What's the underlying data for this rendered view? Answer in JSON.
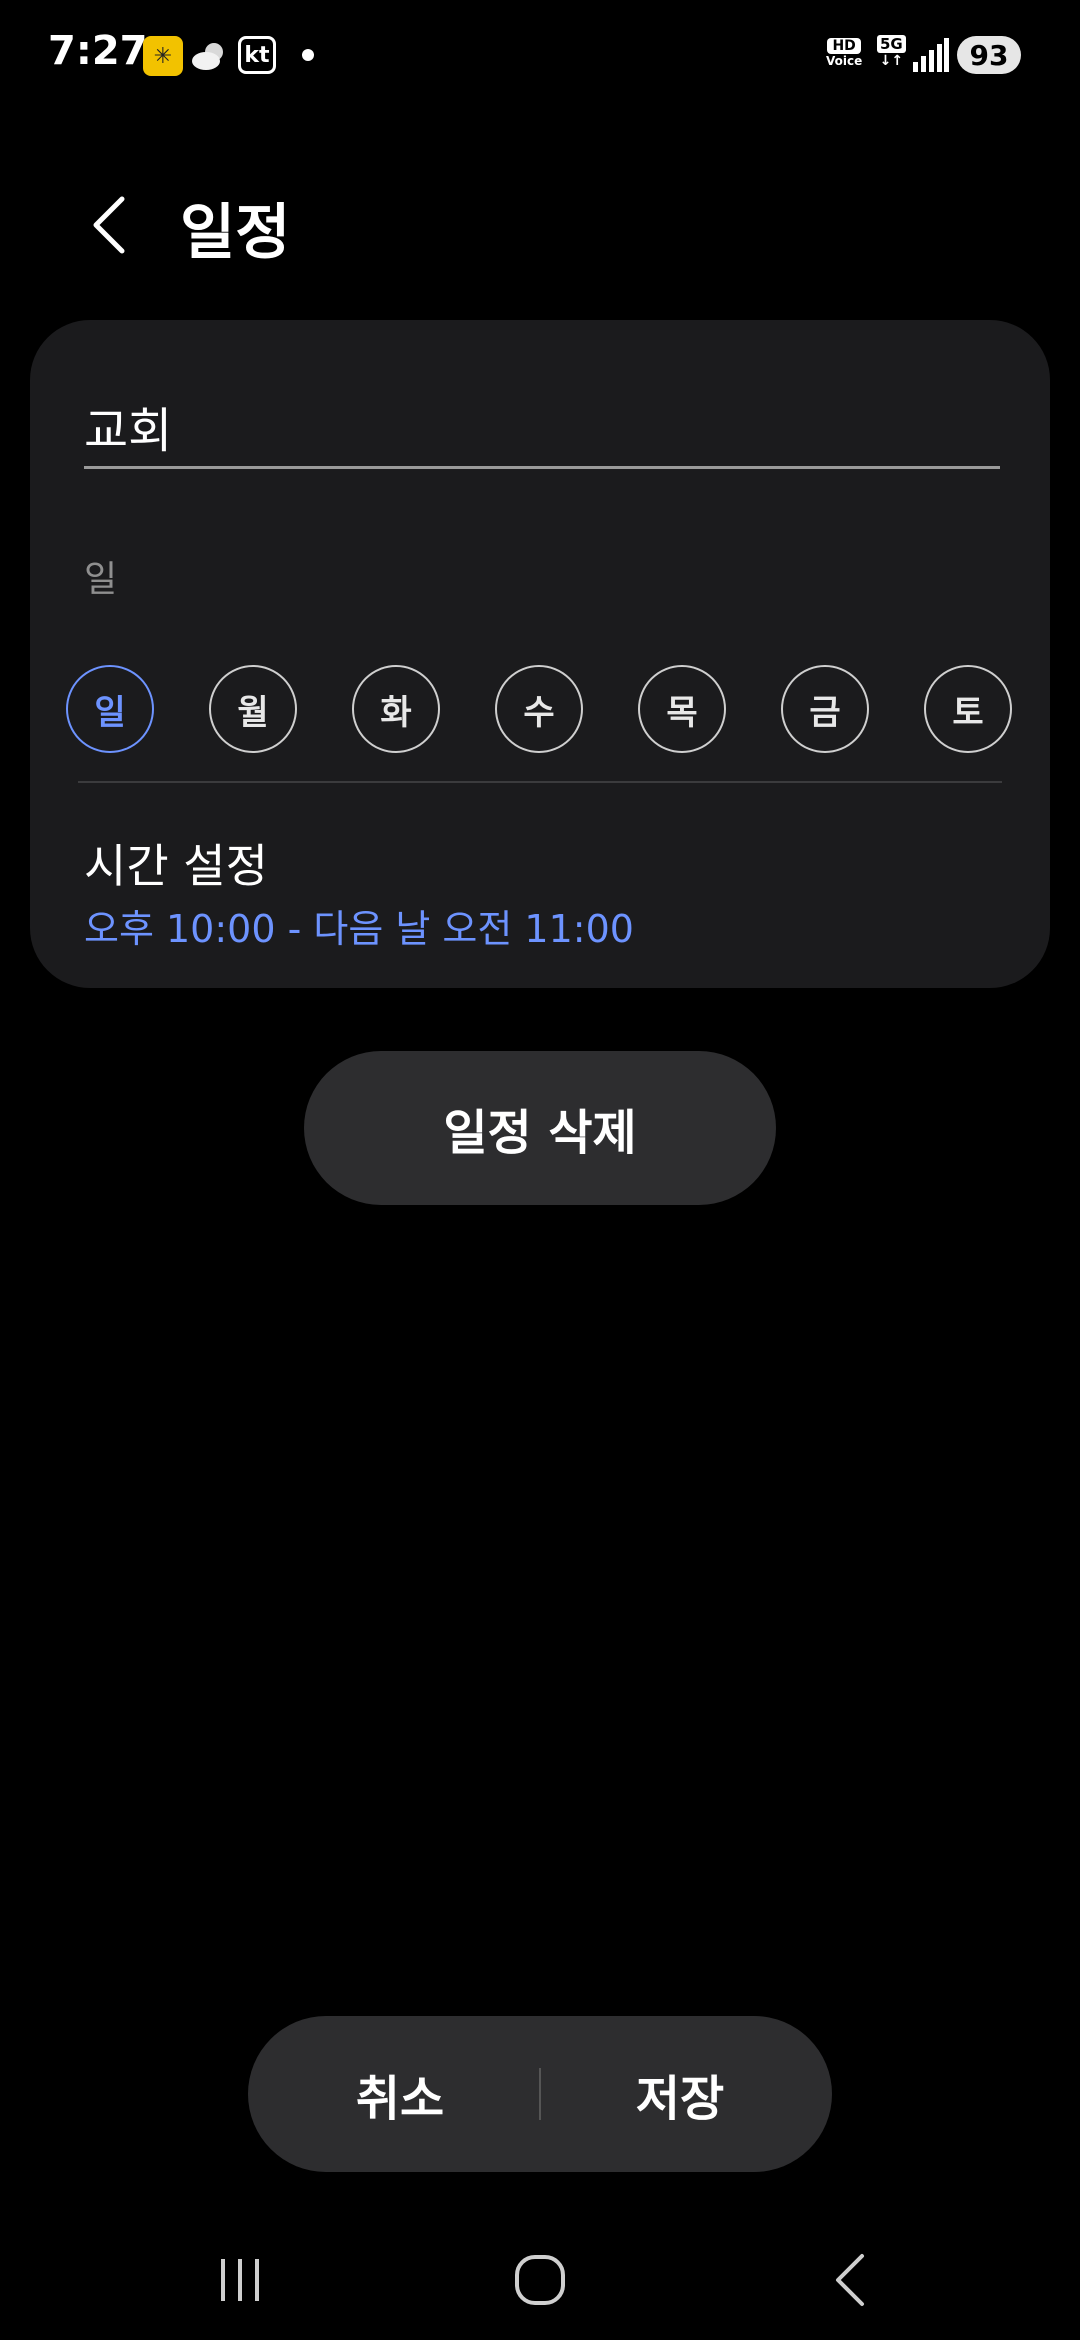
{
  "status": {
    "time": "7:27",
    "hd_top": "HD",
    "hd_bottom": "Voice",
    "network": "5G",
    "battery": "93",
    "carrier": "kt"
  },
  "header": {
    "title": "일정"
  },
  "event": {
    "name": "교회",
    "repeat_summary": "일",
    "days": [
      "일",
      "월",
      "화",
      "수",
      "목",
      "금",
      "토"
    ],
    "time_label": "시간 설정",
    "time_value": "오후 10:00 - 다음 날 오전 11:00"
  },
  "actions": {
    "delete_label": "일정 삭제",
    "cancel_label": "취소",
    "save_label": "저장"
  },
  "colors": {
    "accent": "#6d93ff",
    "card_bg": "#1b1b1d",
    "button_bg": "#2d2d2f"
  }
}
